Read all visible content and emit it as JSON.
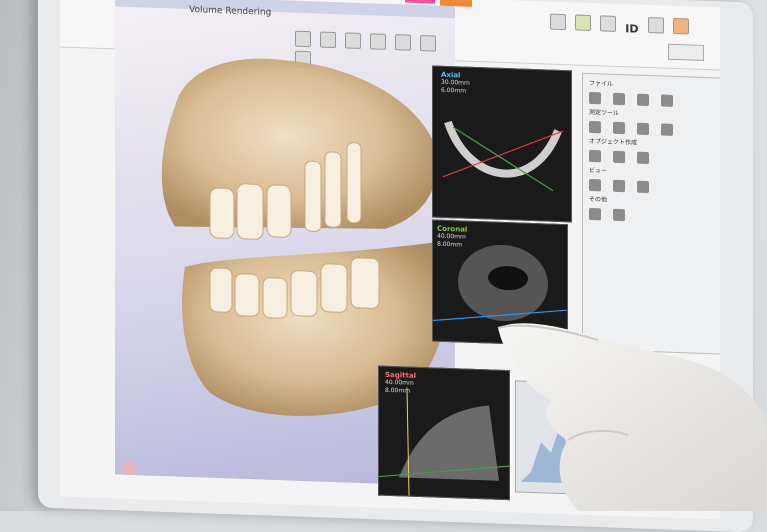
{
  "volume_view": {
    "title": "Volume Rendering"
  },
  "slices": [
    {
      "name": "Axial",
      "thickness": "30.00mm",
      "spacing": "6.00mm",
      "color": "#4fc3f7"
    },
    {
      "name": "Coronal",
      "thickness": "40.00mm",
      "spacing": "8.00mm",
      "color": "#8bc34a"
    },
    {
      "name": "Sagittal",
      "thickness": "40.00mm",
      "spacing": "8.00mm",
      "color": "#ff6b6b"
    }
  ],
  "side_panel": {
    "sections": [
      {
        "label": "ファイル"
      },
      {
        "label": "測定ツール"
      },
      {
        "label": "オブジェクト作成"
      },
      {
        "label": "ビュー"
      },
      {
        "label": "その他"
      }
    ]
  },
  "top_toolbar": {
    "id_label": "ID"
  },
  "colors": {
    "teeth": "#d8b98a",
    "background_gradient_bottom": "#b6b8dc",
    "glove": "#f1f0ee"
  }
}
